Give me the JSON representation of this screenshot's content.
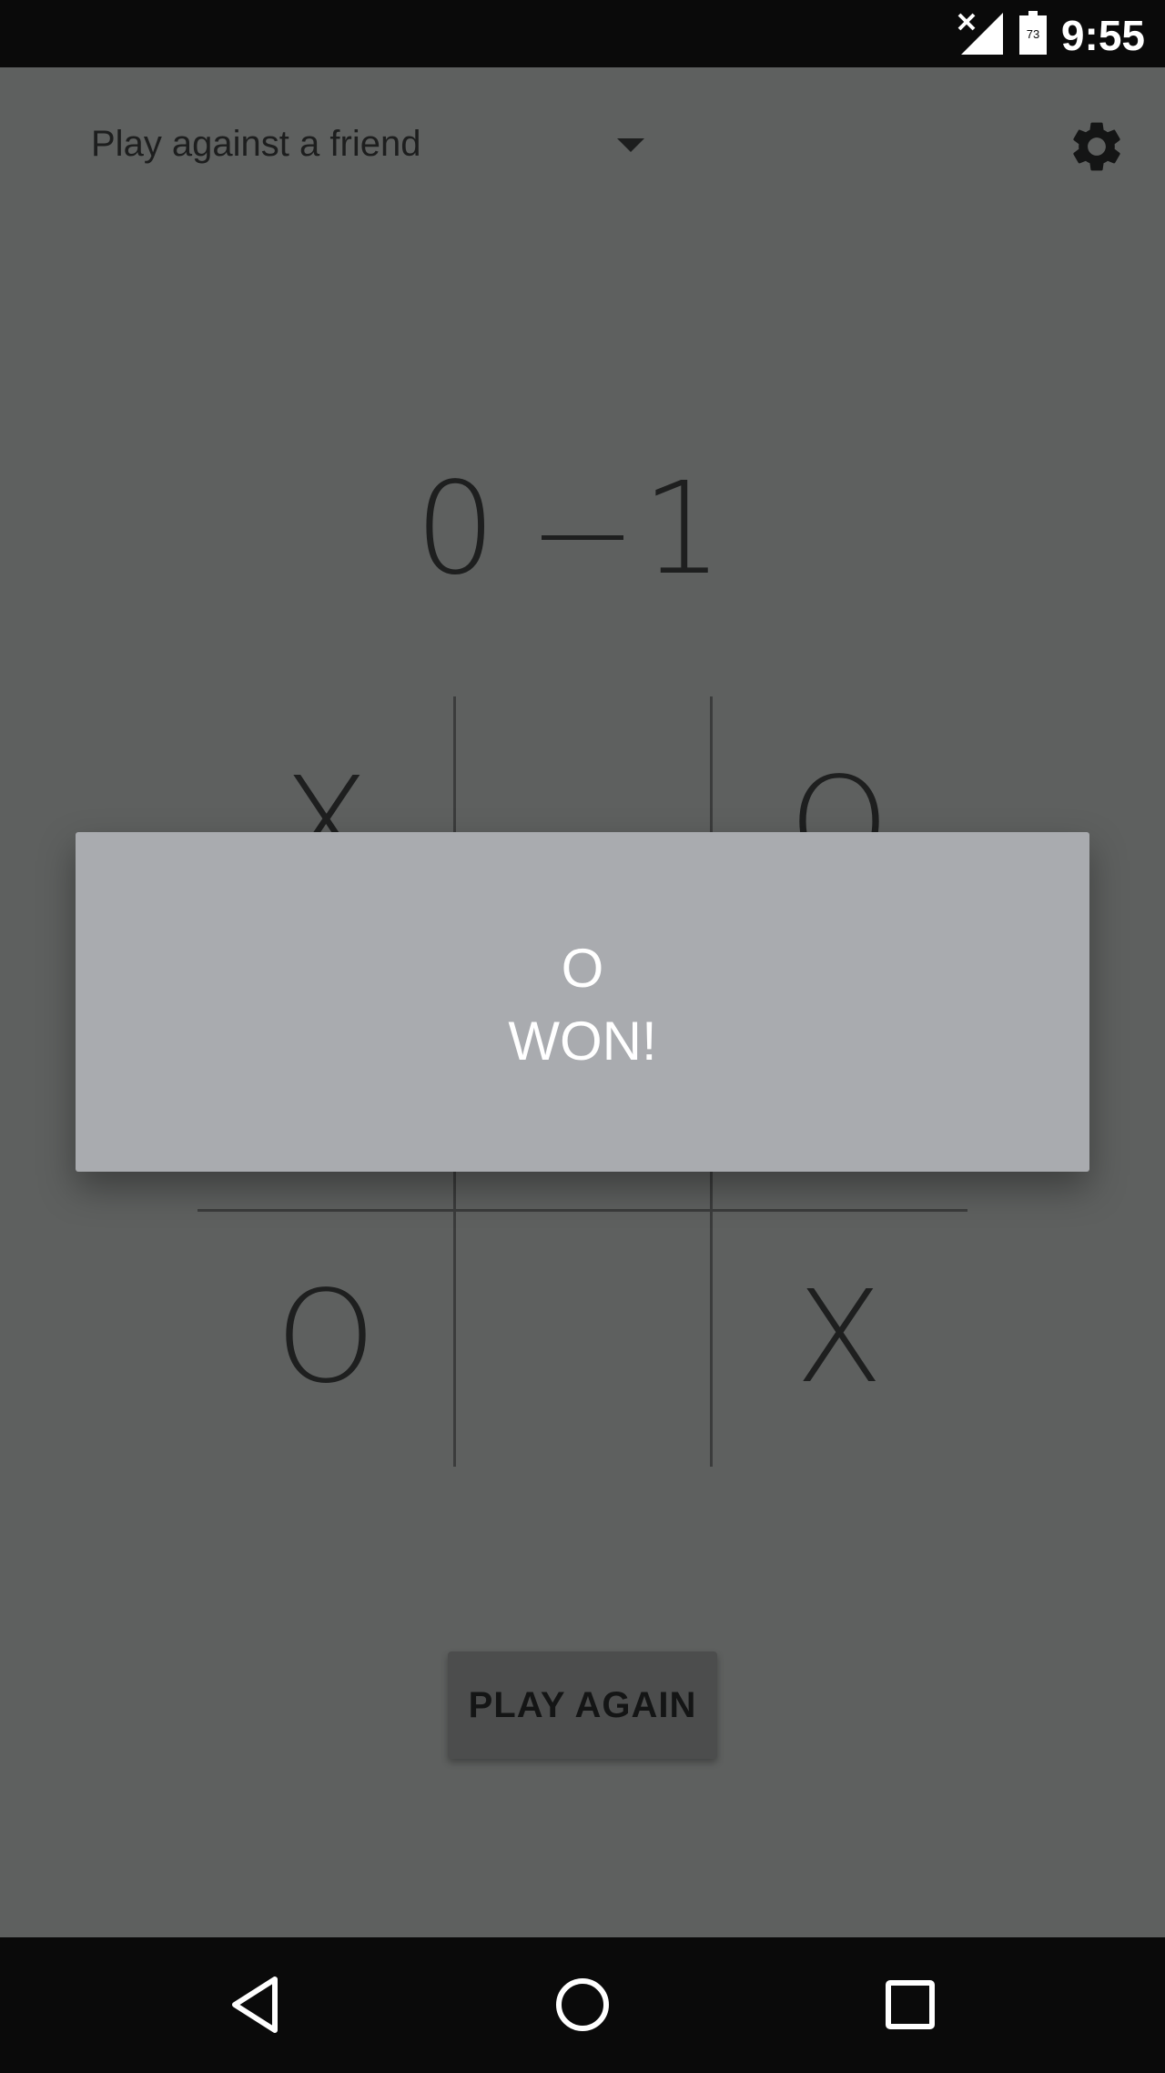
{
  "status_bar": {
    "time": "9:55",
    "battery_level": "73",
    "icons": [
      "signal-off-icon",
      "battery-icon"
    ]
  },
  "header": {
    "mode_label": "Play against a friend",
    "settings_icon": "gear-icon",
    "dropdown_icon": "dropdown-arrow-icon"
  },
  "score": {
    "left": "0",
    "right": "1"
  },
  "board": {
    "cells": [
      "X",
      "",
      "O",
      "",
      "",
      "",
      "O",
      "",
      "X"
    ]
  },
  "dialog": {
    "line1": "O",
    "line2": "WON!"
  },
  "actions": {
    "play_again_label": "PLAY AGAIN"
  },
  "nav_bar": {
    "icons": [
      "back-icon",
      "home-icon",
      "recents-icon"
    ]
  },
  "colors": {
    "background": "#5e605f",
    "dialog": "#a9abaf",
    "button": "#4c4d4d"
  }
}
